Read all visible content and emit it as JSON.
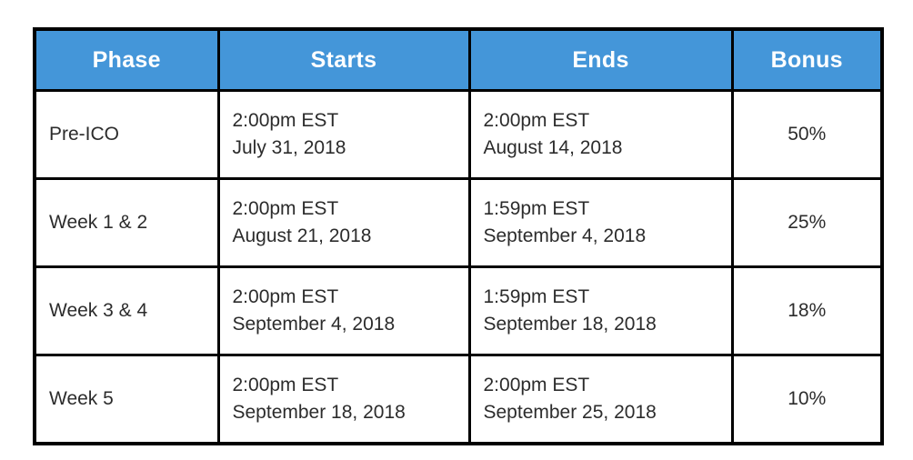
{
  "table": {
    "accent_color": "#4496d9",
    "border_color": "#010101",
    "text_color": "#2c2c2c",
    "header_text_color": "#ffffff",
    "columns": [
      {
        "key": "phase",
        "label": "Phase"
      },
      {
        "key": "starts",
        "label": "Starts"
      },
      {
        "key": "ends",
        "label": "Ends"
      },
      {
        "key": "bonus",
        "label": "Bonus"
      }
    ],
    "rows": [
      {
        "phase": "Pre-ICO",
        "starts_time": "2:00pm EST",
        "starts_date": "July 31, 2018",
        "ends_time": "2:00pm EST",
        "ends_date": "August 14, 2018",
        "bonus": "50%"
      },
      {
        "phase": "Week 1 & 2",
        "starts_time": "2:00pm EST",
        "starts_date": "August 21, 2018",
        "ends_time": "1:59pm EST",
        "ends_date": "September 4, 2018",
        "bonus": "25%"
      },
      {
        "phase": "Week 3 & 4",
        "starts_time": "2:00pm EST",
        "starts_date": "September 4, 2018",
        "ends_time": "1:59pm EST",
        "ends_date": "September 18, 2018",
        "bonus": "18%"
      },
      {
        "phase": "Week 5",
        "starts_time": "2:00pm EST",
        "starts_date": "September 18, 2018",
        "ends_time": "2:00pm EST",
        "ends_date": "September 25, 2018",
        "bonus": "10%"
      }
    ]
  }
}
